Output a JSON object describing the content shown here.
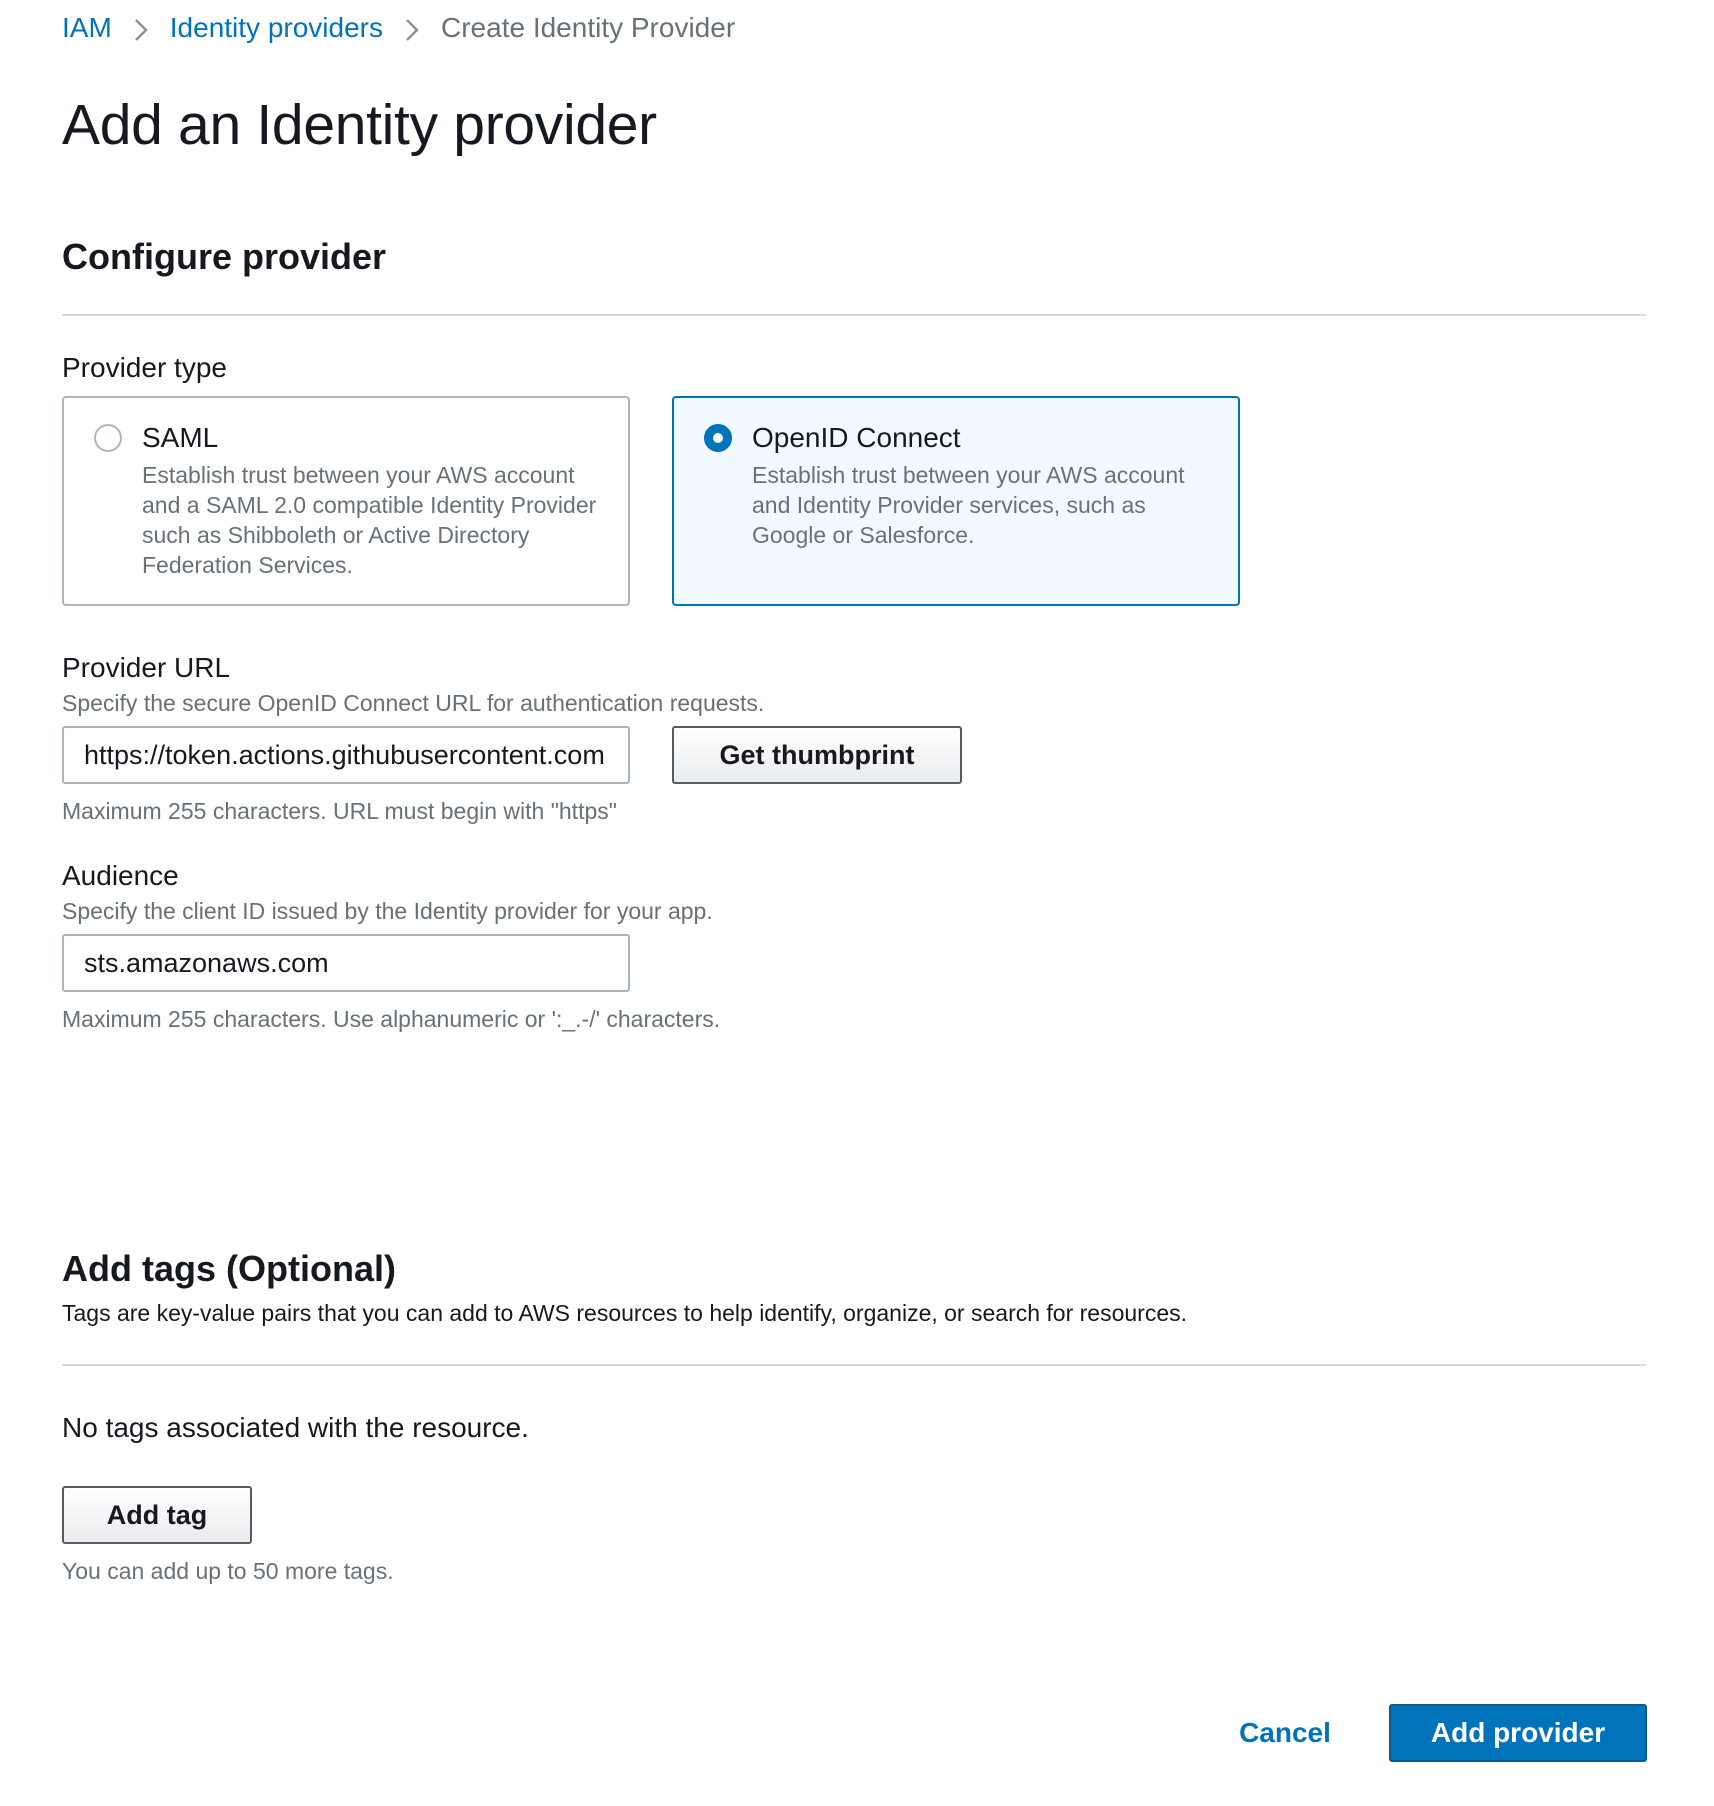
{
  "breadcrumb": {
    "items": [
      "IAM",
      "Identity providers",
      "Create Identity Provider"
    ]
  },
  "page": {
    "title": "Add an Identity provider"
  },
  "configure": {
    "section_title": "Configure provider",
    "provider_type_label": "Provider type",
    "options": [
      {
        "title": "SAML",
        "description": "Establish trust between your AWS account and a SAML 2.0 compatible Identity Provider such as Shibboleth or Active Directory Federation Services.",
        "selected": false
      },
      {
        "title": "OpenID Connect",
        "description": "Establish trust between your AWS account and Identity Provider services, such as Google or Salesforce.",
        "selected": true
      }
    ],
    "provider_url": {
      "label": "Provider URL",
      "description": "Specify the secure OpenID Connect URL for authentication requests.",
      "value": "https://token.actions.githubusercontent.com",
      "hint": "Maximum 255 characters. URL must begin with \"https\"",
      "thumbprint_button": "Get thumbprint"
    },
    "audience": {
      "label": "Audience",
      "description": "Specify the client ID issued by the Identity provider for your app.",
      "value": "sts.amazonaws.com",
      "hint": "Maximum 255 characters. Use alphanumeric or ':_.-/' characters."
    }
  },
  "tags": {
    "section_title": "Add tags (Optional)",
    "description": "Tags are key-value pairs that you can add to AWS resources to help identify, organize, or search for resources.",
    "empty_text": "No tags associated with the resource.",
    "add_button": "Add tag",
    "limit_hint": "You can add up to 50 more tags."
  },
  "footer": {
    "cancel_label": "Cancel",
    "submit_label": "Add provider"
  },
  "colors": {
    "link": "#0073bb",
    "primary_button": "#0073bb",
    "selected_tile_bg": "#f1faff",
    "muted_text": "#687078"
  }
}
